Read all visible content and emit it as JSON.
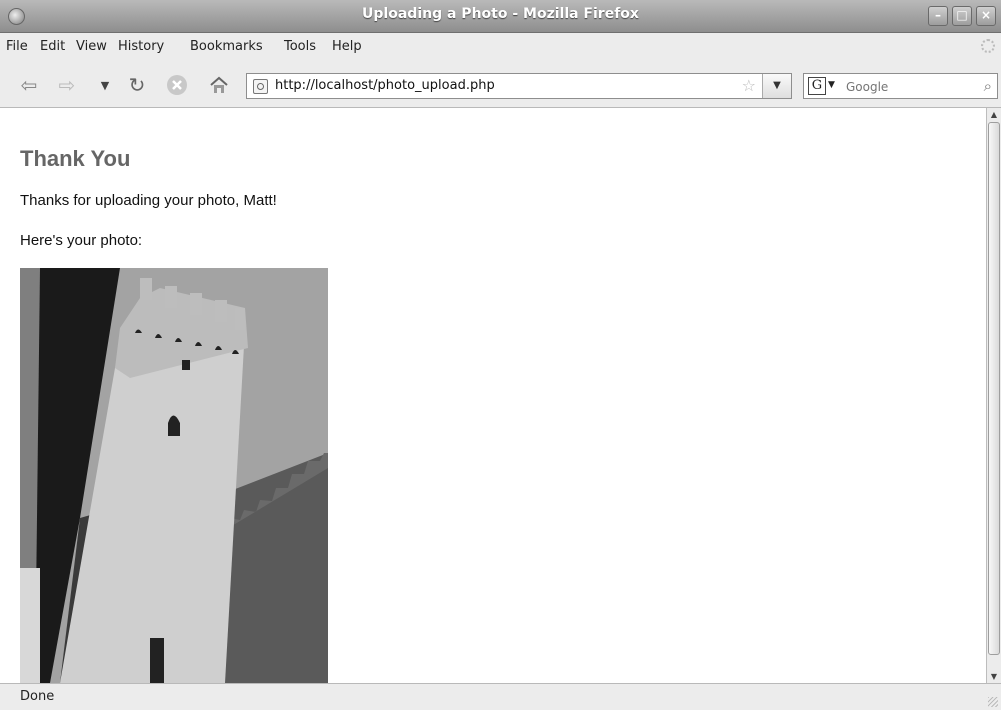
{
  "window": {
    "title": "Uploading a Photo - Mozilla Firefox"
  },
  "menu": {
    "items": [
      "File",
      "Edit",
      "View",
      "History",
      "Bookmarks",
      "Tools",
      "Help"
    ]
  },
  "toolbar": {
    "url": "http://localhost/photo_upload.php",
    "search_engine": "G",
    "search_placeholder": "Google",
    "icons": [
      "back-arrow-icon",
      "forward-arrow-icon",
      "history-dropdown-icon",
      "reload-icon",
      "stop-icon",
      "home-icon",
      "site-identity-icon",
      "bookmark-star-icon",
      "url-dropdown-icon",
      "search-magnifier-icon"
    ]
  },
  "page": {
    "heading": "Thank You",
    "message": "Thanks for uploading your photo, Matt!",
    "photo_label": "Here's your photo:"
  },
  "status": {
    "text": "Done"
  },
  "colors": {
    "heading": "#666666",
    "titlebar": "#9a9a9a",
    "chrome": "#ececec"
  }
}
